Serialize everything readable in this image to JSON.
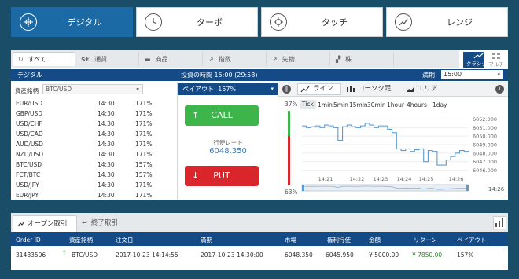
{
  "top_tabs": [
    {
      "label": "デジタル",
      "icon": "digital-icon",
      "active": true
    },
    {
      "label": "ターボ",
      "icon": "turbo-icon",
      "active": false
    },
    {
      "label": "タッチ",
      "icon": "touch-icon",
      "active": false
    },
    {
      "label": "レンジ",
      "icon": "range-icon",
      "active": false
    }
  ],
  "categories": [
    {
      "label": "すべて",
      "icon": "refresh-icon",
      "symbol": "↻"
    },
    {
      "label": "通貨",
      "icon": "currency-icon",
      "symbol": "$€"
    },
    {
      "label": "商品",
      "icon": "commodity-icon",
      "symbol": "▬"
    },
    {
      "label": "指数",
      "icon": "index-icon",
      "symbol": "↗"
    },
    {
      "label": "先物",
      "icon": "futures-icon",
      "symbol": "↗"
    },
    {
      "label": "株",
      "icon": "stock-icon",
      "symbol": "▞"
    }
  ],
  "view_modes": {
    "classic": "クラシック",
    "multi": "マルチ"
  },
  "bar": {
    "mode": "デジタル",
    "investment_time": "投資の時間 15:00 (29:58)",
    "expiry_label": "満期",
    "expiry_value": "15:00"
  },
  "asset_list": {
    "header": "資産銘柄",
    "selected": "BTC/USD",
    "rows": [
      {
        "name": "EUR/USD",
        "time": "14:30",
        "payout": "171%"
      },
      {
        "name": "GBP/USD",
        "time": "14:30",
        "payout": "171%"
      },
      {
        "name": "USD/CHF",
        "time": "14:30",
        "payout": "171%"
      },
      {
        "name": "USD/CAD",
        "time": "14:30",
        "payout": "171%"
      },
      {
        "name": "AUD/USD",
        "time": "14:30",
        "payout": "171%"
      },
      {
        "name": "NZD/USD",
        "time": "14:30",
        "payout": "171%"
      },
      {
        "name": "BTC/USD",
        "time": "14:30",
        "payout": "157%"
      },
      {
        "name": "FCT/BTC",
        "time": "14:30",
        "payout": "157%"
      },
      {
        "name": "USD/JPY",
        "time": "14:30",
        "payout": "171%"
      },
      {
        "name": "EUR/JPY",
        "time": "14:30",
        "payout": "171%"
      }
    ]
  },
  "trade": {
    "payout": "ペイアウト: 157%",
    "call": "CALL",
    "put": "PUT",
    "strike_label": "行使レート",
    "strike_value": "6048.350"
  },
  "chart": {
    "tabs": [
      "ライン",
      "ローソク足",
      "エリア"
    ],
    "info": "i",
    "pct_top": "37%",
    "pct_bottom": "63%",
    "tick": "Tick",
    "ranges": [
      "1min",
      "5min",
      "15min",
      "30min",
      "1hour",
      "4hours",
      "1day"
    ],
    "time_end": "14:26"
  },
  "chart_data": {
    "type": "line",
    "x": [
      "14:21",
      "14:22",
      "14:23",
      "14:24",
      "14:25",
      "14:26"
    ],
    "yticks": [
      "6052.000",
      "6051.000",
      "6050.000",
      "6049.000",
      "6048.000",
      "6047.000",
      "6046.000"
    ],
    "ylim": [
      6045.5,
      6052.5
    ],
    "values": [
      6051.2,
      6051.0,
      6051.1,
      6051.2,
      6051.0,
      6051.3,
      6051.2,
      6051.0,
      6049.5,
      6051.1,
      6051.3,
      6051.1,
      6051.0,
      6051.2,
      6051.5,
      6051.3,
      6051.0,
      6051.2,
      6051.2,
      6050.8,
      6050.4,
      6048.5,
      6048.3,
      6048.5,
      6048.2,
      6048.4,
      6048.5,
      6047.0,
      6048.3,
      6048.2,
      6046.6,
      6046.6,
      6047.2,
      6047.6,
      6048.0,
      6048.3,
      6048.2,
      6048.3
    ],
    "color": "#5b9bd5"
  },
  "orders": {
    "tabs": [
      "オープン取引",
      "終了取引"
    ],
    "columns": [
      "Order ID",
      "資産銘柄",
      "注文日",
      "満期",
      "市場",
      "権利行使",
      "金額",
      "リターン",
      "ペイアウト"
    ],
    "rows": [
      {
        "id": "31483506",
        "asset": "BTC/USD",
        "date": "2017-10-23 14:14:55",
        "expiry": "2017-10-23 14:30:00",
        "market": "6048.350",
        "strike": "6045.950",
        "amount": "¥ 5000.00",
        "return": "¥ 7850.00",
        "payout": "157%"
      }
    ]
  },
  "colors": {
    "call": "#3db54a",
    "put": "#d9262c",
    "accent": "#144a85",
    "tab_active": "#1b6aa5",
    "return": "#2e8b2e"
  }
}
